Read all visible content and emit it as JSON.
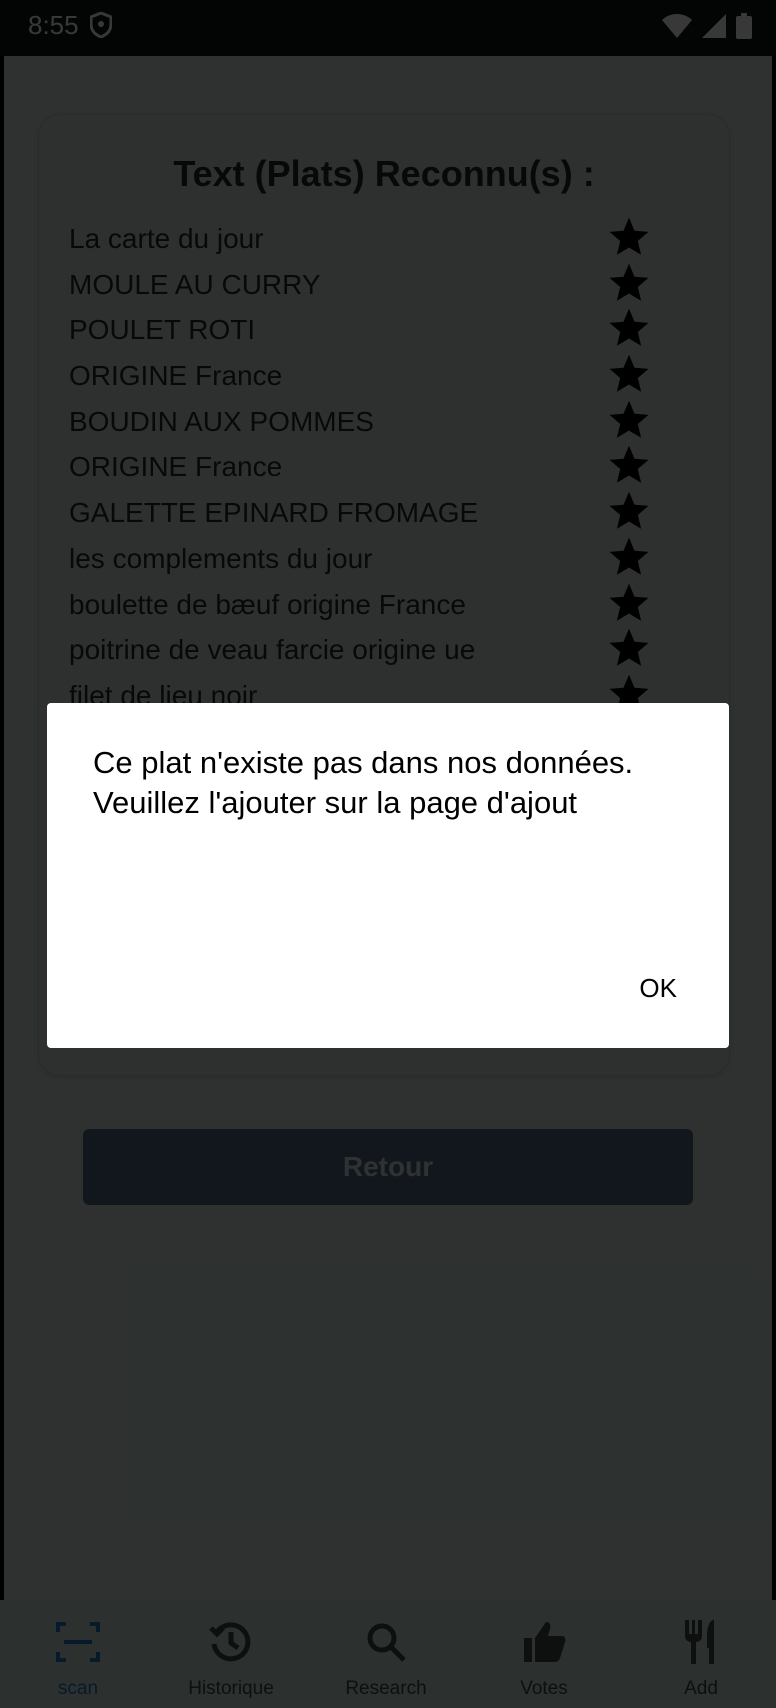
{
  "status_bar": {
    "time": "8:55"
  },
  "card": {
    "title": "Text (Plats) Reconnu(s) :",
    "dishes": [
      "La carte du jour",
      "MOULE AU CURRY",
      "POULET ROTI",
      "ORIGINE France",
      "BOUDIN AUX POMMES",
      "ORIGINE France",
      "GALETTE EPINARD FROMAGE",
      "les complements du jour",
      "boulette de bæuf origine France",
      "poitrine de veau farcie origine ue",
      "filet de lieu noir"
    ]
  },
  "back_button": {
    "label": "Retour"
  },
  "dialog": {
    "message": "Ce plat n'existe pas dans nos données. Veuillez l'ajouter sur la page d'ajout",
    "ok_label": "OK"
  },
  "bottom_nav": {
    "items": [
      {
        "label": "scan",
        "icon": "scan-icon",
        "active": true
      },
      {
        "label": "Historique",
        "icon": "history-icon"
      },
      {
        "label": "Research",
        "icon": "search-icon"
      },
      {
        "label": "Votes",
        "icon": "thumb-up-icon"
      },
      {
        "label": "Add",
        "icon": "restaurant-icon"
      }
    ],
    "active_color": "#2b74c7"
  }
}
